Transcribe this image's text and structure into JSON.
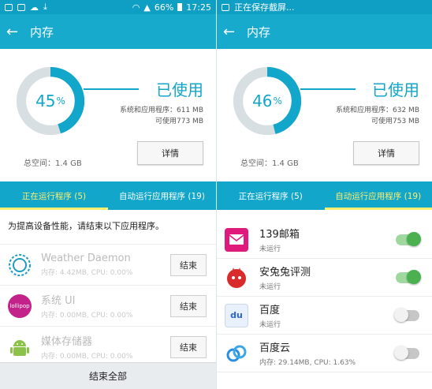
{
  "left": {
    "status": {
      "percent": "66%",
      "time": "17:25"
    },
    "appbar_title": "内存",
    "memory": {
      "used_percent": 45,
      "used_percent_text": "45",
      "percent_sign": "%",
      "used_label": "已使用",
      "system_line": "系统和应用程序：611 MB",
      "available_line": "可使用773 MB",
      "total_space": "总空间：1.4 GB",
      "detail_button": "详情"
    },
    "tabs": [
      {
        "label": "正在运行程序 (5)",
        "active": true
      },
      {
        "label": "自动运行应用程序 (19)",
        "active": false
      }
    ],
    "hint": "为提高设备性能，请结束以下应用程序。",
    "apps": [
      {
        "name": "Weather Daemon",
        "info": "内存: 4.42MB, CPU: 0.00%",
        "button": "结束",
        "icon": "weather-daemon-icon"
      },
      {
        "name": "系统 UI",
        "info": "内存: 0.00MB, CPU: 0.00%",
        "button": "结束",
        "icon": "lollipop-icon",
        "icon_text": "lollipop"
      },
      {
        "name": "媒体存储器",
        "info": "内存: 0.00MB, CPU: 0.00%",
        "button": "结束",
        "icon": "android-icon"
      }
    ],
    "end_all": "结束全部"
  },
  "right": {
    "status": {
      "text": "正在保存截屏..."
    },
    "appbar_title": "内存",
    "memory": {
      "used_percent": 46,
      "used_percent_text": "46",
      "percent_sign": "%",
      "used_label": "已使用",
      "system_line": "系统和应用程序：632 MB",
      "available_line": "可使用753 MB",
      "total_space": "总空间：1.4 GB",
      "detail_button": "详情"
    },
    "tabs": [
      {
        "label": "正在运行程序 (5)",
        "active": false
      },
      {
        "label": "自动运行应用程序 (19)",
        "active": true
      }
    ],
    "apps": [
      {
        "name": "139邮箱",
        "status": "未运行",
        "enabled": true,
        "icon": "mail-139-icon",
        "icon_text": "139"
      },
      {
        "name": "安兔兔评测",
        "status": "未运行",
        "enabled": true,
        "icon": "antutu-icon"
      },
      {
        "name": "百度",
        "status": "未运行",
        "enabled": false,
        "icon": "baidu-icon",
        "icon_text": "du"
      },
      {
        "name": "百度云",
        "status": "内存: 29.14MB, CPU: 1.63%",
        "enabled": false,
        "icon": "baidu-cloud-icon"
      }
    ]
  },
  "colors": {
    "accent": "#11a6ca",
    "tab_active": "#ffef70",
    "switch_on": "#4bb04f",
    "ring_track": "#d8dfe2"
  }
}
